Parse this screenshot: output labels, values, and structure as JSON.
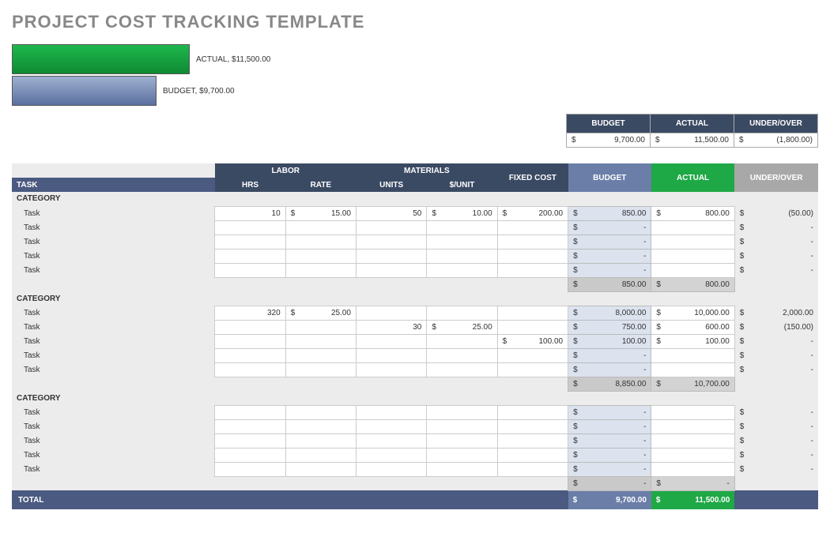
{
  "title": "PROJECT COST TRACKING TEMPLATE",
  "chart_data": {
    "type": "bar",
    "orientation": "horizontal",
    "categories": [
      "ACTUAL",
      "BUDGET"
    ],
    "values": [
      11500.0,
      9700.0
    ],
    "title": "",
    "xlabel": "",
    "ylabel": "",
    "series_colors": [
      "#1fa846",
      "#6a7ea8"
    ]
  },
  "chart_labels": {
    "actual": "ACTUAL,  $11,500.00",
    "budget": "BUDGET,  $9,700.00"
  },
  "summary": {
    "headers": {
      "budget": "BUDGET",
      "actual": "ACTUAL",
      "uo": "UNDER/OVER"
    },
    "budget": "9,700.00",
    "actual": "11,500.00",
    "uo": "(1,800.00)"
  },
  "table": {
    "group_headers": {
      "labor": "LABOR",
      "materials": "MATERIALS",
      "fixed": "FIXED COST"
    },
    "col_headers": {
      "task": "TASK",
      "hrs": "HRS",
      "rate": "RATE",
      "units": "UNITS",
      "punit": "$/UNIT",
      "budget": "BUDGET",
      "actual": "ACTUAL",
      "uo": "UNDER/OVER"
    },
    "category_label": "CATEGORY",
    "task_label": "Task",
    "sections": [
      {
        "rows": [
          {
            "hrs": "10",
            "rate": "15.00",
            "units": "50",
            "punit": "10.00",
            "fixed": "200.00",
            "budget": "850.00",
            "actual": "800.00",
            "uo": "(50.00)"
          },
          {
            "budget": "-",
            "uo": "-"
          },
          {
            "budget": "-",
            "uo": "-"
          },
          {
            "budget": "-",
            "uo": "-"
          },
          {
            "budget": "-",
            "uo": "-"
          }
        ],
        "subtotal": {
          "budget": "850.00",
          "actual": "800.00"
        }
      },
      {
        "rows": [
          {
            "hrs": "320",
            "rate": "25.00",
            "budget": "8,000.00",
            "actual": "10,000.00",
            "uo": "2,000.00"
          },
          {
            "units": "30",
            "punit": "25.00",
            "budget": "750.00",
            "actual": "600.00",
            "uo": "(150.00)"
          },
          {
            "fixed": "100.00",
            "budget": "100.00",
            "actual": "100.00",
            "uo": "-"
          },
          {
            "budget": "-",
            "uo": "-"
          },
          {
            "budget": "-",
            "uo": "-"
          }
        ],
        "subtotal": {
          "budget": "8,850.00",
          "actual": "10,700.00"
        }
      },
      {
        "rows": [
          {
            "budget": "-",
            "uo": "-"
          },
          {
            "budget": "-",
            "uo": "-"
          },
          {
            "budget": "-",
            "uo": "-"
          },
          {
            "budget": "-",
            "uo": "-"
          },
          {
            "budget": "-",
            "uo": "-"
          }
        ],
        "subtotal": {
          "budget": "-",
          "actual": "-"
        }
      }
    ],
    "total": {
      "label": "TOTAL",
      "budget": "9,700.00",
      "actual": "11,500.00"
    }
  },
  "currency_symbol": "$"
}
